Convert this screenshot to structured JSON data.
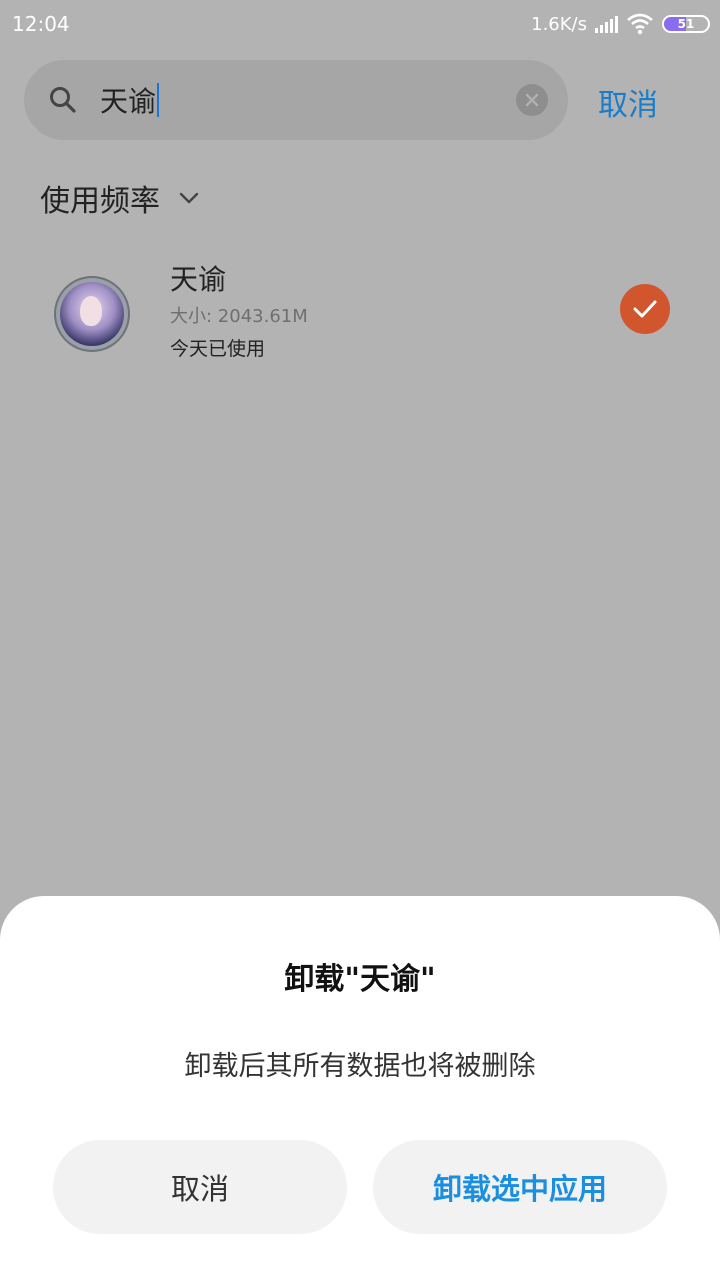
{
  "status_bar": {
    "time": "12:04",
    "net_speed": "1.6K/s",
    "battery_level": "51",
    "battery_percent": 51,
    "icons": [
      "signal-icon",
      "wifi-icon",
      "battery-icon"
    ]
  },
  "search": {
    "query": "天谕",
    "cancel_label": "取消",
    "icons": [
      "search-icon",
      "clear-icon"
    ]
  },
  "sort": {
    "label": "使用频率",
    "icon": "chevron-down-icon"
  },
  "app": {
    "name": "天谕",
    "size": "大小: 2043.61M",
    "last_used": "今天已使用",
    "selected": true,
    "check_color": "#d2562d"
  },
  "dialog": {
    "title": "卸载\"天谕\"",
    "message": "卸载后其所有数据也将被删除",
    "cancel_label": "取消",
    "confirm_label": "卸载选中应用",
    "confirm_color": "#1a8ee0"
  }
}
